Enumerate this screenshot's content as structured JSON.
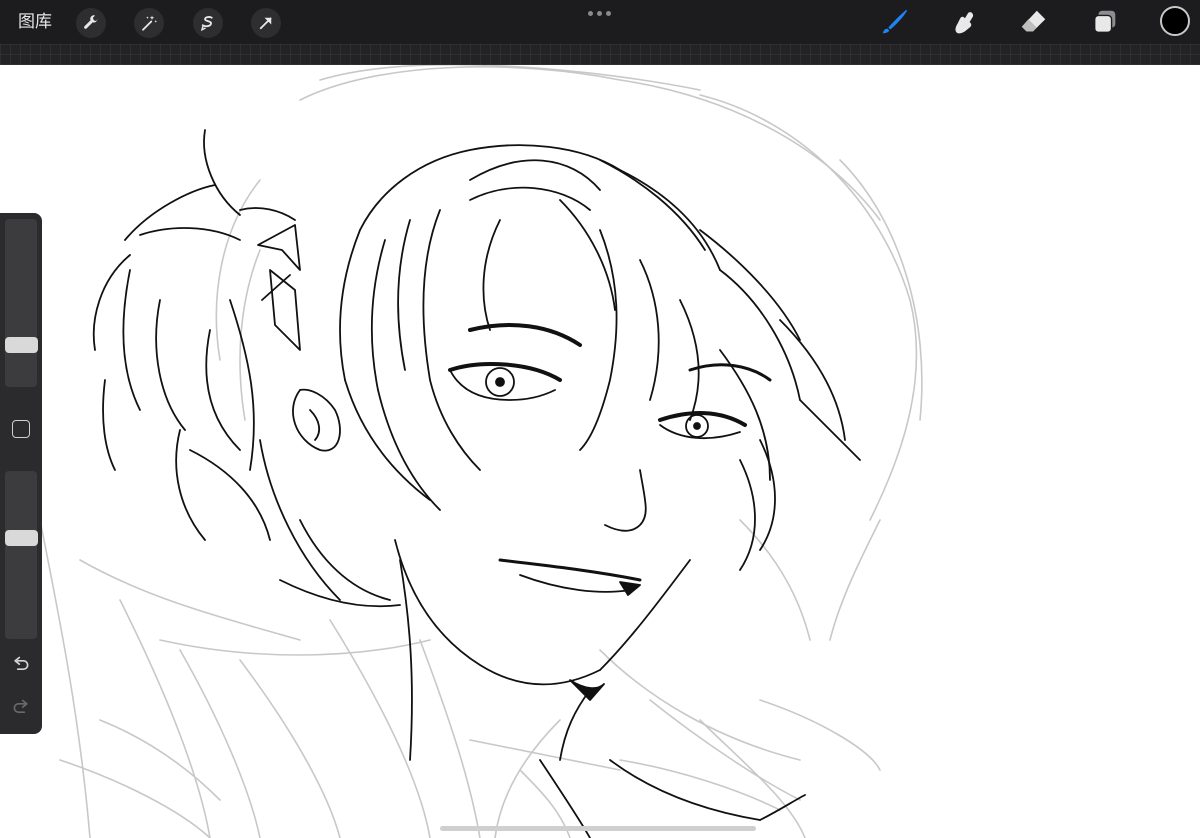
{
  "app": {
    "gallery_label": "图库"
  },
  "toolbar": {
    "left_tools": [
      "actions",
      "adjustments",
      "selection",
      "transform"
    ],
    "right_tools": [
      "brush",
      "smudge",
      "eraser",
      "layers"
    ],
    "active_tool": "brush",
    "accent_color": "#1e84f5",
    "current_color": "#000000"
  },
  "sidebar": {
    "brush_size_level": 0.25,
    "opacity_level": 0.62,
    "controls": [
      "modifier",
      "undo",
      "redo"
    ]
  }
}
